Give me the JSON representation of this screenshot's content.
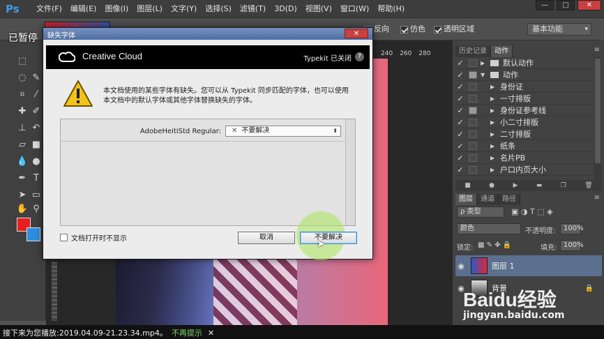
{
  "app": {
    "logo": "Ps"
  },
  "menu": [
    "文件(F)",
    "编辑(E)",
    "图像(I)",
    "图层(L)",
    "文字(Y)",
    "选择(S)",
    "滤镜(T)",
    "3D(D)",
    "视图(V)",
    "窗口(W)",
    "帮助(H)"
  ],
  "window_controls": {
    "minimize": "—",
    "maximize": "□",
    "close": "✕"
  },
  "options_bar": {
    "reverse_label": "反向",
    "dither_label": "仿色",
    "transparency_label": "透明区域",
    "workspace": "基本功能"
  },
  "overlay": {
    "paused": "已暂停"
  },
  "ruler": {
    "ticks": [
      "240",
      "260",
      "280"
    ]
  },
  "dialog": {
    "title": "缺失字体",
    "close_label": "✕",
    "cc_name": "Creative Cloud",
    "typekit_status": "Typekit 已关闭",
    "help_label": "?",
    "message": "本文档使用的某些字体有缺失。您可以从 Typekit 同步匹配的字体，也可以使用本文档中的默认字体或其他字体替换缺失的字体。",
    "missing_font": "AdobeHeitiStd Regular:",
    "resolve_value": "不要解决",
    "dont_show_label": "文档打开时不显示",
    "cancel_label": "取消",
    "dont_resolve_label": "不要解决"
  },
  "panels": {
    "top_tabs": [
      "历史记录",
      "动作"
    ],
    "actions": [
      {
        "label": "默认动作",
        "type": "folder",
        "checked": true
      },
      {
        "label": "动作",
        "type": "folder",
        "checked": true
      },
      {
        "label": "身份证",
        "type": "action",
        "checked": true
      },
      {
        "label": "一寸排版",
        "type": "action",
        "checked": true
      },
      {
        "label": "身份证参考线",
        "type": "action",
        "checked": true
      },
      {
        "label": "小二寸排版",
        "type": "action",
        "checked": true
      },
      {
        "label": "二寸排版",
        "type": "action",
        "checked": true
      },
      {
        "label": "纸条",
        "type": "action",
        "checked": true
      },
      {
        "label": "名片PB",
        "type": "action",
        "checked": true
      },
      {
        "label": "户口内页大小",
        "type": "action",
        "checked": true
      }
    ],
    "layer_tabs": [
      "图层",
      "通道",
      "路径"
    ],
    "filter_kind": "ρ 类型",
    "blend_mode": "颜色",
    "opacity_label": "不透明度:",
    "opacity_value": "100%",
    "lock_label": "锁定:",
    "fill_label": "填充:",
    "fill_value": "100%",
    "layers": [
      {
        "name": "图层 1"
      },
      {
        "name": "背景"
      }
    ]
  },
  "notification": {
    "text": "接下来为您播放:2019.04.09-21.23.34.mp4。",
    "link": "不再提示",
    "close": "✕"
  },
  "watermark": {
    "brand": "Baidu经验",
    "url": "jingyan.baidu.com"
  }
}
